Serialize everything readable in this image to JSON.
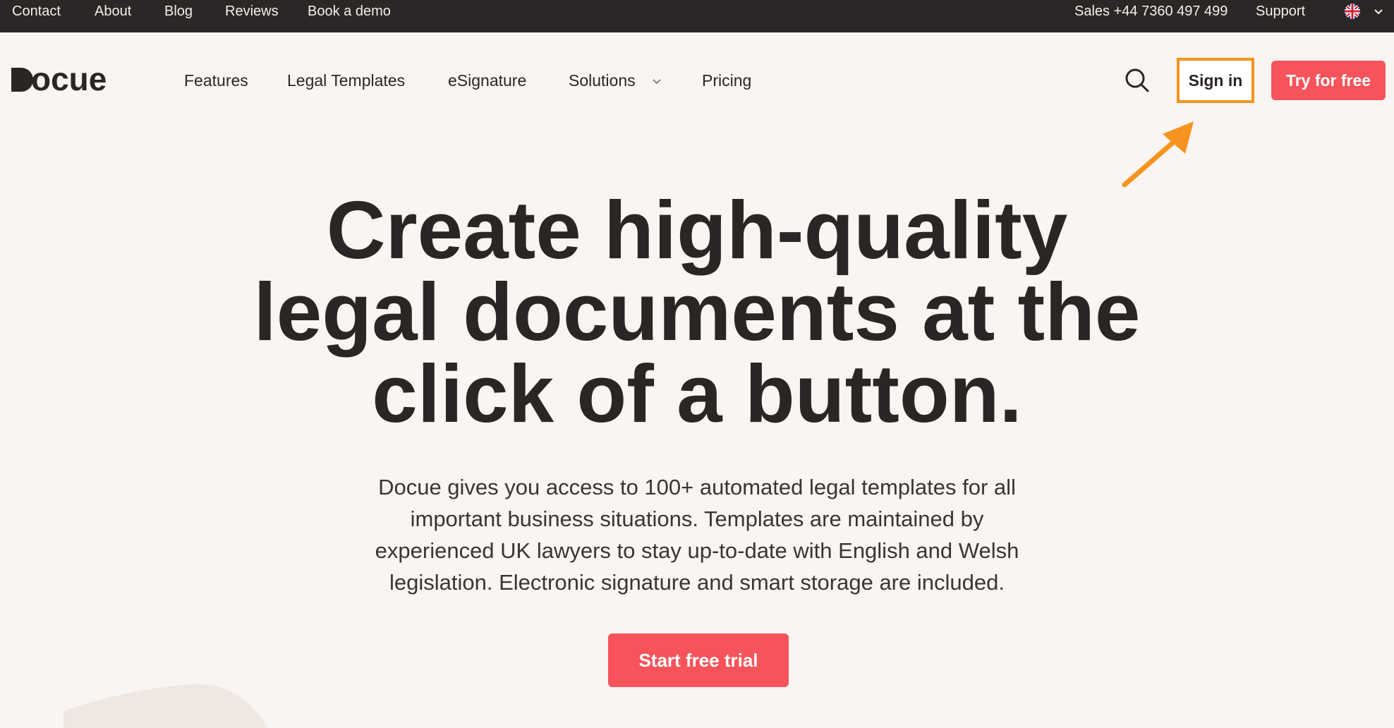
{
  "topbar": {
    "links": [
      "Contact",
      "About",
      "Blog",
      "Reviews",
      "Book a demo"
    ],
    "sales": "Sales +44 7360 497 499",
    "support": "Support",
    "language_icon": "uk-flag-icon"
  },
  "brand": {
    "logo_text": "ocue"
  },
  "nav": {
    "features": "Features",
    "legal_templates": "Legal Templates",
    "esignature": "eSignature",
    "solutions": "Solutions",
    "pricing": "Pricing",
    "sign_in": "Sign in",
    "try_free": "Try for free"
  },
  "hero": {
    "headline_line1": "Create high-quality",
    "headline_line2": "legal documents at the",
    "headline_line3": "click of a button.",
    "sub_line1": "Docue gives you access to 100+ automated legal templates for all",
    "sub_line2": "important business situations. Templates are maintained by",
    "sub_line3": "experienced UK lawyers to stay up-to-date with English and Welsh",
    "sub_line4": "legislation. Electronic signature and smart storage are included.",
    "cta": "Start free trial"
  },
  "colors": {
    "accent": "#f6535a",
    "highlight": "#f6941f",
    "topbar_bg": "#2b2726",
    "page_bg": "#f8f5f2"
  }
}
